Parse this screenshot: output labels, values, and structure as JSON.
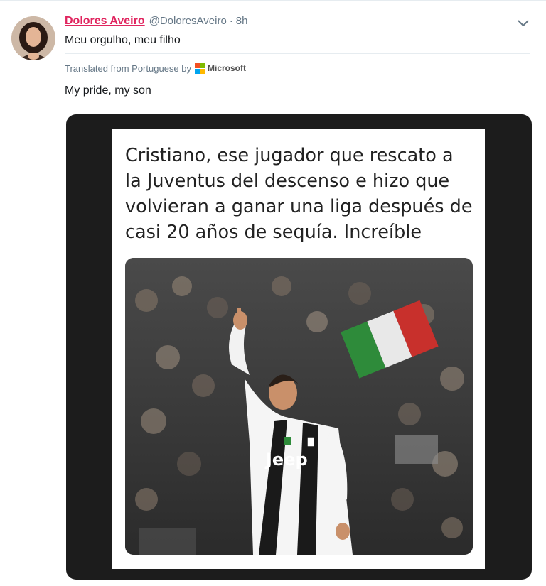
{
  "tweet": {
    "display_name": "Dolores Aveiro",
    "handle": "@DoloresAveiro",
    "separator": "·",
    "time": "8h",
    "text": "Meu orgulho, meu filho",
    "translated_label": "Translated from Portuguese by",
    "translator_name": "Microsoft",
    "translation": "My pride, my son"
  },
  "media": {
    "meme_text": "Cristiano, ese jugador que rescato a\nla Juventus del descenso e hizo que\nvolvieran a ganar una liga después de\ncasi 20 años de sequía. Increíble",
    "jersey_sponsor": "Jeep"
  },
  "icons": {
    "caret": "chevron-down-icon",
    "translator_logo": "microsoft-logo-icon"
  },
  "colors": {
    "display_name": "#e0245e",
    "secondary_text": "#657786",
    "primary_text": "#14171a",
    "media_background": "#1c1c1c"
  }
}
